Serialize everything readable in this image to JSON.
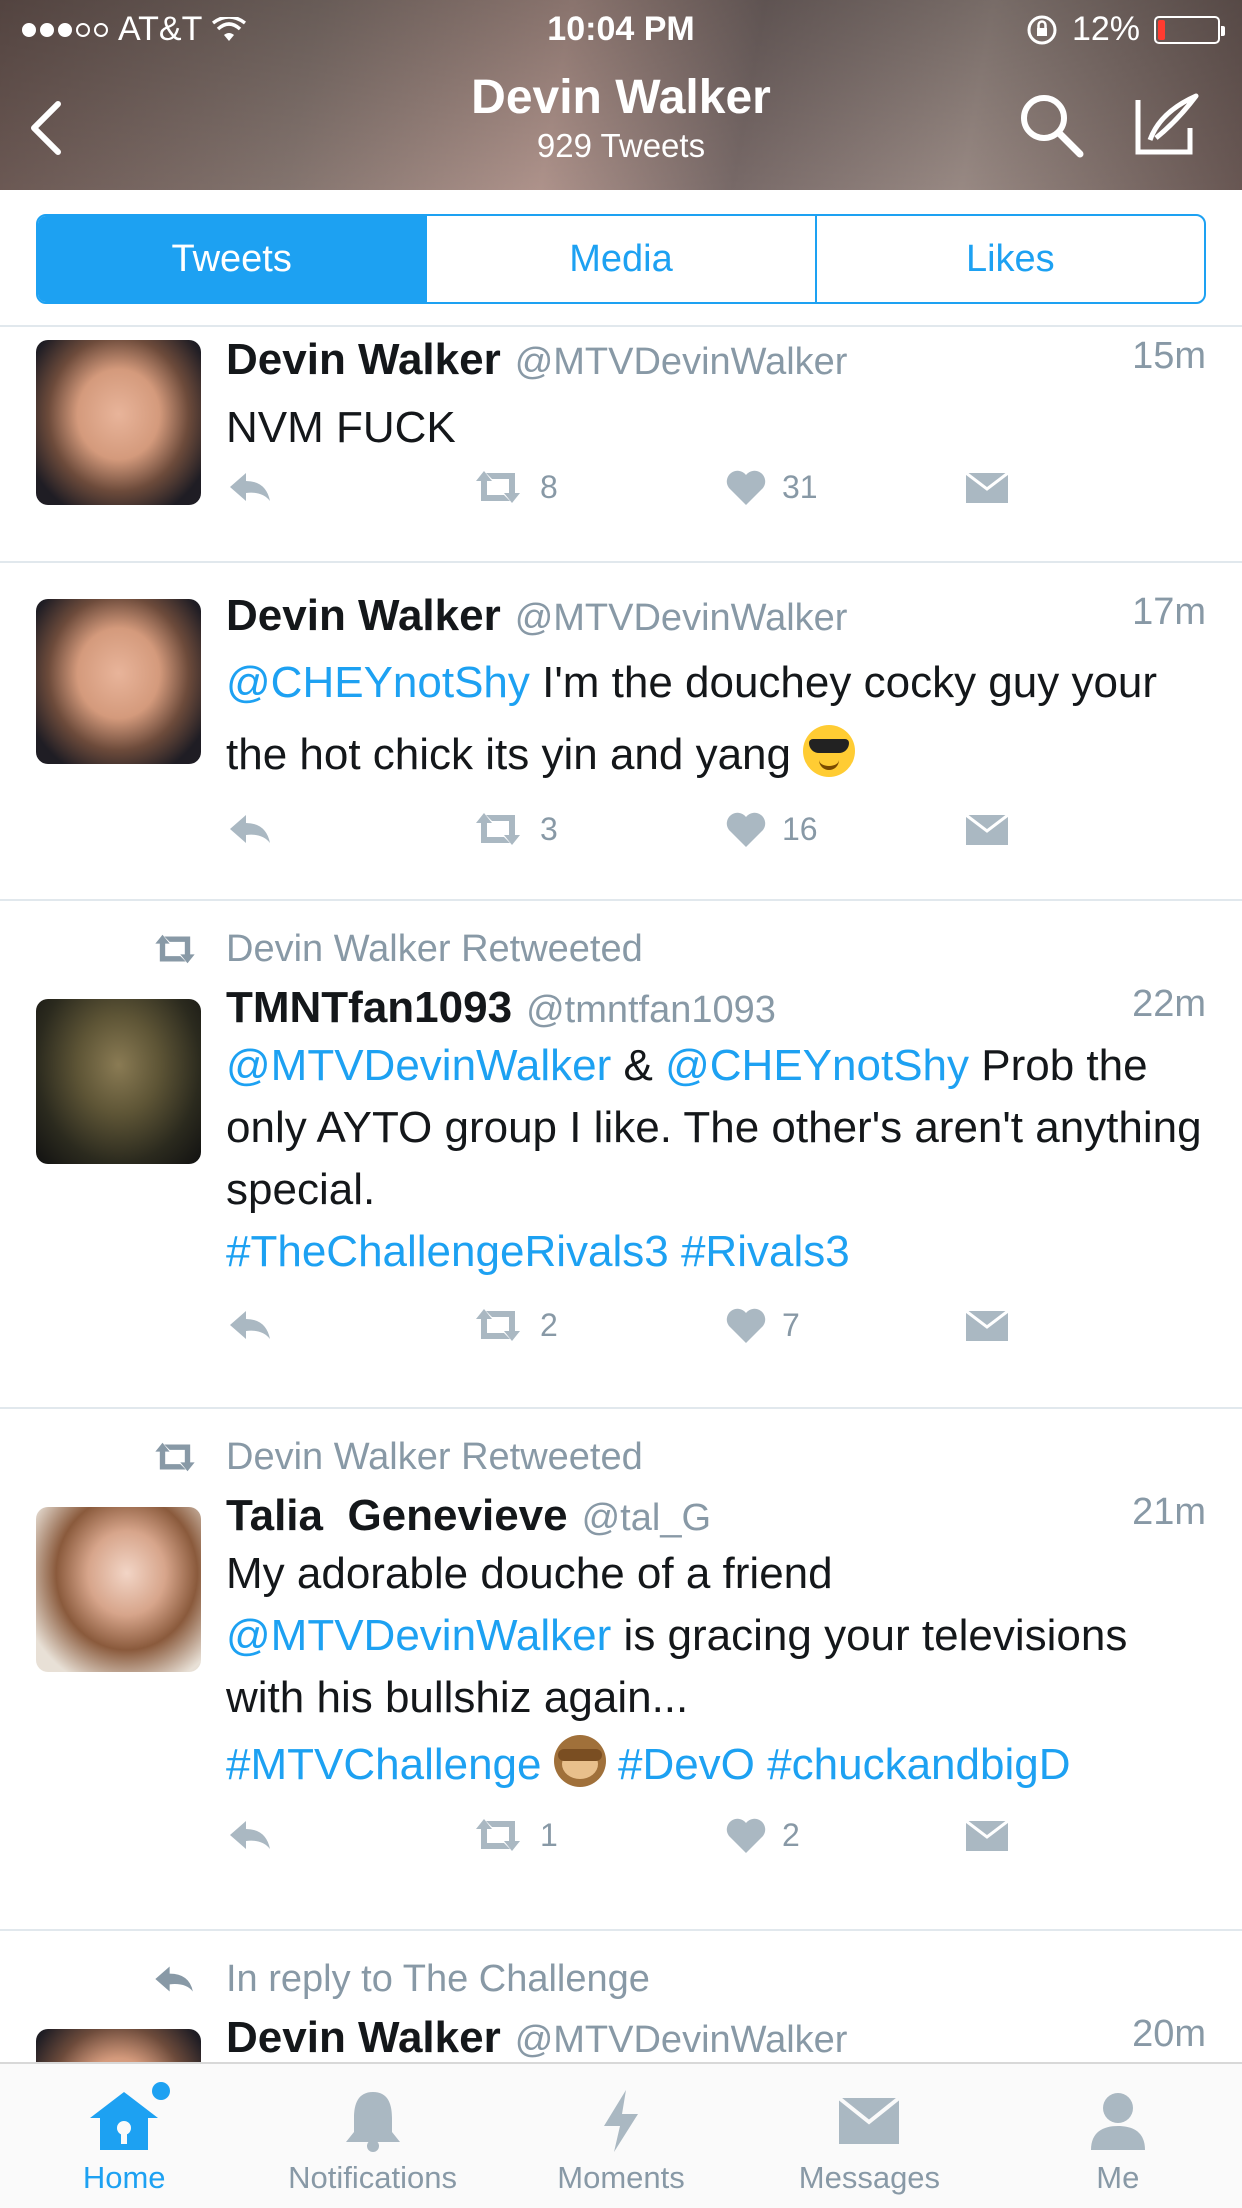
{
  "status_bar": {
    "carrier": "AT&T",
    "time": "10:04 PM",
    "battery": "12%",
    "battery_level": 0.12
  },
  "header": {
    "title": "Devin Walker",
    "subtitle": "929 Tweets"
  },
  "segments": [
    {
      "label": "Tweets",
      "active": true
    },
    {
      "label": "Media",
      "active": false
    },
    {
      "label": "Likes",
      "active": false
    }
  ],
  "tweets": [
    {
      "context": "",
      "name": "Devin Walker",
      "handle": "@MTVDevinWalker",
      "time": "15m",
      "text": "NVM FUCK",
      "retweets": "8",
      "likes": "31"
    },
    {
      "context": "",
      "name": "Devin Walker",
      "handle": "@MTVDevinWalker",
      "time": "17m",
      "mention": "@CHEYnotShy",
      "text": " I'm the douchey cocky guy your the hot chick its yin and yang ",
      "retweets": "3",
      "likes": "16"
    },
    {
      "context": "Devin Walker Retweeted",
      "name": "TMNTfan1093",
      "handle": "@tmntfan1093",
      "time": "22m",
      "mention1": "@MTVDevinWalker",
      "amp": " & ",
      "mention2": "@CHEYnotShy",
      "text": " Prob the only AYTO group I like. The other's aren't anything special.",
      "hashtag1": "#TheChallengeRivals3",
      "hashtag2": "#Rivals3",
      "retweets": "2",
      "likes": "7"
    },
    {
      "context": "Devin Walker Retweeted",
      "name": "Talia  Genevieve",
      "handle": "@tal_G",
      "time": "21m",
      "text1": "My adorable douche of a friend",
      "mention": "@MTVDevinWalker",
      "text2": " is gracing your televisions with his bullshiz again...",
      "hashtag1": "#MTVChallenge",
      "hashtag2": "#DevO",
      "hashtag3": "#chuckandbigD",
      "retweets": "1",
      "likes": "2"
    },
    {
      "context": "In reply to The Challenge",
      "name": "Devin Walker",
      "handle": "@MTVDevinWalker",
      "time": "20m"
    }
  ],
  "tabbar": [
    {
      "label": "Home",
      "icon": "home-icon",
      "active": true
    },
    {
      "label": "Notifications",
      "icon": "bell-icon",
      "active": false
    },
    {
      "label": "Moments",
      "icon": "lightning-icon",
      "active": false
    },
    {
      "label": "Messages",
      "icon": "envelope-icon",
      "active": false
    },
    {
      "label": "Me",
      "icon": "person-icon",
      "active": false
    }
  ],
  "colors": {
    "accent": "#1da1f2",
    "muted": "#8899a6",
    "text": "#14171a"
  }
}
